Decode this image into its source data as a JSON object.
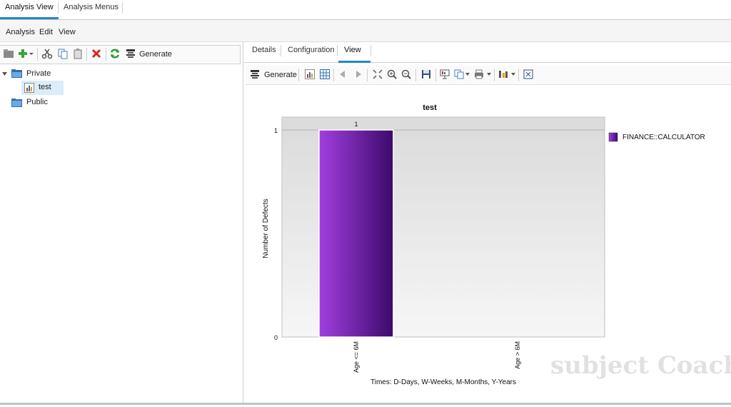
{
  "top_tabs": [
    {
      "label": "Analysis View",
      "active": true
    },
    {
      "label": "Analysis Menus",
      "active": false
    }
  ],
  "menubar": [
    "Analysis",
    "Edit",
    "View"
  ],
  "left_toolbar": {
    "generate_label": "Generate"
  },
  "tree": {
    "private": {
      "label": "Private",
      "children": [
        {
          "label": "test"
        }
      ]
    },
    "public": {
      "label": "Public"
    }
  },
  "right_tabs": [
    {
      "label": "Details",
      "active": false
    },
    {
      "label": "Configuration",
      "active": false
    },
    {
      "label": "View",
      "active": true
    }
  ],
  "right_toolbar": {
    "generate_label": "Generate"
  },
  "colors": {
    "accent": "#1f88c6",
    "bar_light": "#a13fe0",
    "bar_dark": "#3d0a6b",
    "delete": "#d9261c",
    "refresh": "#2e9a2e"
  },
  "watermark": "subject Coach",
  "chart_data": {
    "type": "bar",
    "title": "test",
    "categories": [
      "Age <= 6M",
      "Age > 6M"
    ],
    "series": [
      {
        "name": "FINANCE::CALCULATOR",
        "values": [
          1,
          0
        ]
      }
    ],
    "data_labels": [
      "1",
      ""
    ],
    "xlabel": "Times: D-Days, W-Weeks, M-Months, Y-Years",
    "ylabel": "Number of Defects",
    "ylim": [
      0,
      1
    ],
    "yticks": [
      0,
      1
    ],
    "grid": true,
    "legend_position": "right"
  }
}
